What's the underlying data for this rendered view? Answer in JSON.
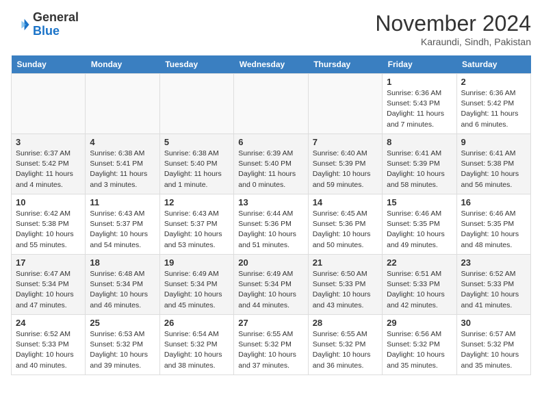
{
  "logo": {
    "general": "General",
    "blue": "Blue"
  },
  "title": "November 2024",
  "subtitle": "Karaundi, Sindh, Pakistan",
  "weekdays": [
    "Sunday",
    "Monday",
    "Tuesday",
    "Wednesday",
    "Thursday",
    "Friday",
    "Saturday"
  ],
  "weeks": [
    [
      {
        "day": "",
        "info": ""
      },
      {
        "day": "",
        "info": ""
      },
      {
        "day": "",
        "info": ""
      },
      {
        "day": "",
        "info": ""
      },
      {
        "day": "",
        "info": ""
      },
      {
        "day": "1",
        "info": "Sunrise: 6:36 AM\nSunset: 5:43 PM\nDaylight: 11 hours and 7 minutes."
      },
      {
        "day": "2",
        "info": "Sunrise: 6:36 AM\nSunset: 5:42 PM\nDaylight: 11 hours and 6 minutes."
      }
    ],
    [
      {
        "day": "3",
        "info": "Sunrise: 6:37 AM\nSunset: 5:42 PM\nDaylight: 11 hours and 4 minutes."
      },
      {
        "day": "4",
        "info": "Sunrise: 6:38 AM\nSunset: 5:41 PM\nDaylight: 11 hours and 3 minutes."
      },
      {
        "day": "5",
        "info": "Sunrise: 6:38 AM\nSunset: 5:40 PM\nDaylight: 11 hours and 1 minute."
      },
      {
        "day": "6",
        "info": "Sunrise: 6:39 AM\nSunset: 5:40 PM\nDaylight: 11 hours and 0 minutes."
      },
      {
        "day": "7",
        "info": "Sunrise: 6:40 AM\nSunset: 5:39 PM\nDaylight: 10 hours and 59 minutes."
      },
      {
        "day": "8",
        "info": "Sunrise: 6:41 AM\nSunset: 5:39 PM\nDaylight: 10 hours and 58 minutes."
      },
      {
        "day": "9",
        "info": "Sunrise: 6:41 AM\nSunset: 5:38 PM\nDaylight: 10 hours and 56 minutes."
      }
    ],
    [
      {
        "day": "10",
        "info": "Sunrise: 6:42 AM\nSunset: 5:38 PM\nDaylight: 10 hours and 55 minutes."
      },
      {
        "day": "11",
        "info": "Sunrise: 6:43 AM\nSunset: 5:37 PM\nDaylight: 10 hours and 54 minutes."
      },
      {
        "day": "12",
        "info": "Sunrise: 6:43 AM\nSunset: 5:37 PM\nDaylight: 10 hours and 53 minutes."
      },
      {
        "day": "13",
        "info": "Sunrise: 6:44 AM\nSunset: 5:36 PM\nDaylight: 10 hours and 51 minutes."
      },
      {
        "day": "14",
        "info": "Sunrise: 6:45 AM\nSunset: 5:36 PM\nDaylight: 10 hours and 50 minutes."
      },
      {
        "day": "15",
        "info": "Sunrise: 6:46 AM\nSunset: 5:35 PM\nDaylight: 10 hours and 49 minutes."
      },
      {
        "day": "16",
        "info": "Sunrise: 6:46 AM\nSunset: 5:35 PM\nDaylight: 10 hours and 48 minutes."
      }
    ],
    [
      {
        "day": "17",
        "info": "Sunrise: 6:47 AM\nSunset: 5:34 PM\nDaylight: 10 hours and 47 minutes."
      },
      {
        "day": "18",
        "info": "Sunrise: 6:48 AM\nSunset: 5:34 PM\nDaylight: 10 hours and 46 minutes."
      },
      {
        "day": "19",
        "info": "Sunrise: 6:49 AM\nSunset: 5:34 PM\nDaylight: 10 hours and 45 minutes."
      },
      {
        "day": "20",
        "info": "Sunrise: 6:49 AM\nSunset: 5:34 PM\nDaylight: 10 hours and 44 minutes."
      },
      {
        "day": "21",
        "info": "Sunrise: 6:50 AM\nSunset: 5:33 PM\nDaylight: 10 hours and 43 minutes."
      },
      {
        "day": "22",
        "info": "Sunrise: 6:51 AM\nSunset: 5:33 PM\nDaylight: 10 hours and 42 minutes."
      },
      {
        "day": "23",
        "info": "Sunrise: 6:52 AM\nSunset: 5:33 PM\nDaylight: 10 hours and 41 minutes."
      }
    ],
    [
      {
        "day": "24",
        "info": "Sunrise: 6:52 AM\nSunset: 5:33 PM\nDaylight: 10 hours and 40 minutes."
      },
      {
        "day": "25",
        "info": "Sunrise: 6:53 AM\nSunset: 5:32 PM\nDaylight: 10 hours and 39 minutes."
      },
      {
        "day": "26",
        "info": "Sunrise: 6:54 AM\nSunset: 5:32 PM\nDaylight: 10 hours and 38 minutes."
      },
      {
        "day": "27",
        "info": "Sunrise: 6:55 AM\nSunset: 5:32 PM\nDaylight: 10 hours and 37 minutes."
      },
      {
        "day": "28",
        "info": "Sunrise: 6:55 AM\nSunset: 5:32 PM\nDaylight: 10 hours and 36 minutes."
      },
      {
        "day": "29",
        "info": "Sunrise: 6:56 AM\nSunset: 5:32 PM\nDaylight: 10 hours and 35 minutes."
      },
      {
        "day": "30",
        "info": "Sunrise: 6:57 AM\nSunset: 5:32 PM\nDaylight: 10 hours and 35 minutes."
      }
    ]
  ]
}
